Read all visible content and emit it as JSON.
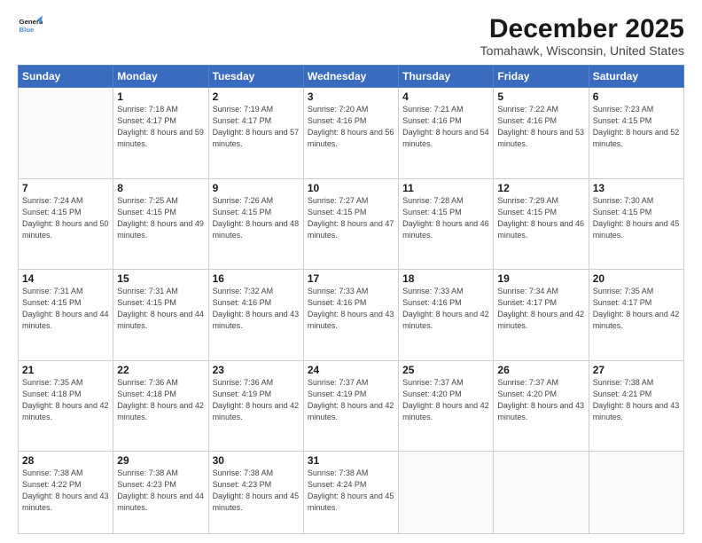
{
  "header": {
    "logo_line1": "General",
    "logo_line2": "Blue",
    "month_year": "December 2025",
    "location": "Tomahawk, Wisconsin, United States"
  },
  "weekdays": [
    "Sunday",
    "Monday",
    "Tuesday",
    "Wednesday",
    "Thursday",
    "Friday",
    "Saturday"
  ],
  "weeks": [
    [
      {
        "day": "",
        "sunrise": "",
        "sunset": "",
        "daylight": ""
      },
      {
        "day": "1",
        "sunrise": "7:18 AM",
        "sunset": "4:17 PM",
        "daylight": "8 hours and 59 minutes."
      },
      {
        "day": "2",
        "sunrise": "7:19 AM",
        "sunset": "4:17 PM",
        "daylight": "8 hours and 57 minutes."
      },
      {
        "day": "3",
        "sunrise": "7:20 AM",
        "sunset": "4:16 PM",
        "daylight": "8 hours and 56 minutes."
      },
      {
        "day": "4",
        "sunrise": "7:21 AM",
        "sunset": "4:16 PM",
        "daylight": "8 hours and 54 minutes."
      },
      {
        "day": "5",
        "sunrise": "7:22 AM",
        "sunset": "4:16 PM",
        "daylight": "8 hours and 53 minutes."
      },
      {
        "day": "6",
        "sunrise": "7:23 AM",
        "sunset": "4:15 PM",
        "daylight": "8 hours and 52 minutes."
      }
    ],
    [
      {
        "day": "7",
        "sunrise": "7:24 AM",
        "sunset": "4:15 PM",
        "daylight": "8 hours and 50 minutes."
      },
      {
        "day": "8",
        "sunrise": "7:25 AM",
        "sunset": "4:15 PM",
        "daylight": "8 hours and 49 minutes."
      },
      {
        "day": "9",
        "sunrise": "7:26 AM",
        "sunset": "4:15 PM",
        "daylight": "8 hours and 48 minutes."
      },
      {
        "day": "10",
        "sunrise": "7:27 AM",
        "sunset": "4:15 PM",
        "daylight": "8 hours and 47 minutes."
      },
      {
        "day": "11",
        "sunrise": "7:28 AM",
        "sunset": "4:15 PM",
        "daylight": "8 hours and 46 minutes."
      },
      {
        "day": "12",
        "sunrise": "7:29 AM",
        "sunset": "4:15 PM",
        "daylight": "8 hours and 46 minutes."
      },
      {
        "day": "13",
        "sunrise": "7:30 AM",
        "sunset": "4:15 PM",
        "daylight": "8 hours and 45 minutes."
      }
    ],
    [
      {
        "day": "14",
        "sunrise": "7:31 AM",
        "sunset": "4:15 PM",
        "daylight": "8 hours and 44 minutes."
      },
      {
        "day": "15",
        "sunrise": "7:31 AM",
        "sunset": "4:15 PM",
        "daylight": "8 hours and 44 minutes."
      },
      {
        "day": "16",
        "sunrise": "7:32 AM",
        "sunset": "4:16 PM",
        "daylight": "8 hours and 43 minutes."
      },
      {
        "day": "17",
        "sunrise": "7:33 AM",
        "sunset": "4:16 PM",
        "daylight": "8 hours and 43 minutes."
      },
      {
        "day": "18",
        "sunrise": "7:33 AM",
        "sunset": "4:16 PM",
        "daylight": "8 hours and 42 minutes."
      },
      {
        "day": "19",
        "sunrise": "7:34 AM",
        "sunset": "4:17 PM",
        "daylight": "8 hours and 42 minutes."
      },
      {
        "day": "20",
        "sunrise": "7:35 AM",
        "sunset": "4:17 PM",
        "daylight": "8 hours and 42 minutes."
      }
    ],
    [
      {
        "day": "21",
        "sunrise": "7:35 AM",
        "sunset": "4:18 PM",
        "daylight": "8 hours and 42 minutes."
      },
      {
        "day": "22",
        "sunrise": "7:36 AM",
        "sunset": "4:18 PM",
        "daylight": "8 hours and 42 minutes."
      },
      {
        "day": "23",
        "sunrise": "7:36 AM",
        "sunset": "4:19 PM",
        "daylight": "8 hours and 42 minutes."
      },
      {
        "day": "24",
        "sunrise": "7:37 AM",
        "sunset": "4:19 PM",
        "daylight": "8 hours and 42 minutes."
      },
      {
        "day": "25",
        "sunrise": "7:37 AM",
        "sunset": "4:20 PM",
        "daylight": "8 hours and 42 minutes."
      },
      {
        "day": "26",
        "sunrise": "7:37 AM",
        "sunset": "4:20 PM",
        "daylight": "8 hours and 43 minutes."
      },
      {
        "day": "27",
        "sunrise": "7:38 AM",
        "sunset": "4:21 PM",
        "daylight": "8 hours and 43 minutes."
      }
    ],
    [
      {
        "day": "28",
        "sunrise": "7:38 AM",
        "sunset": "4:22 PM",
        "daylight": "8 hours and 43 minutes."
      },
      {
        "day": "29",
        "sunrise": "7:38 AM",
        "sunset": "4:23 PM",
        "daylight": "8 hours and 44 minutes."
      },
      {
        "day": "30",
        "sunrise": "7:38 AM",
        "sunset": "4:23 PM",
        "daylight": "8 hours and 45 minutes."
      },
      {
        "day": "31",
        "sunrise": "7:38 AM",
        "sunset": "4:24 PM",
        "daylight": "8 hours and 45 minutes."
      },
      {
        "day": "",
        "sunrise": "",
        "sunset": "",
        "daylight": ""
      },
      {
        "day": "",
        "sunrise": "",
        "sunset": "",
        "daylight": ""
      },
      {
        "day": "",
        "sunrise": "",
        "sunset": "",
        "daylight": ""
      }
    ]
  ]
}
